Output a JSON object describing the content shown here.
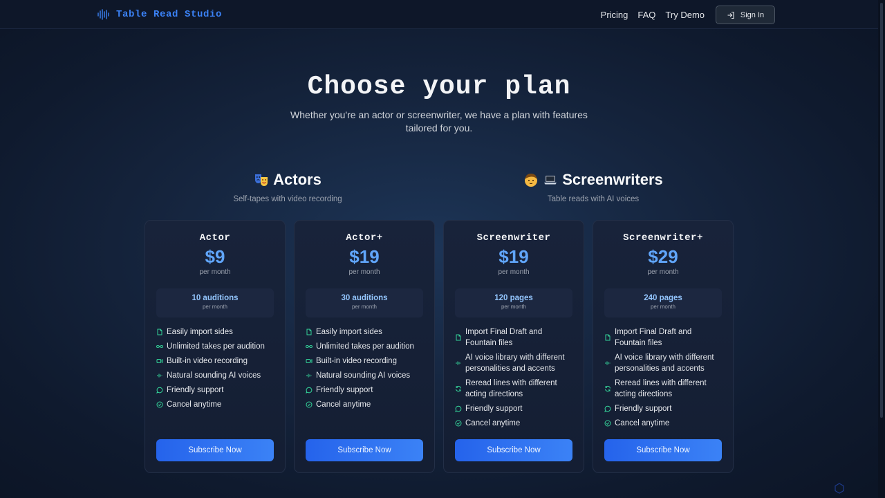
{
  "header": {
    "brand": "Table Read Studio",
    "nav": [
      "Pricing",
      "FAQ",
      "Try Demo"
    ],
    "signin_label": "Sign In"
  },
  "hero": {
    "title": "Choose your plan",
    "subtitle": "Whether you're an actor or screenwriter, we have a plan with features tailored for you."
  },
  "groups": [
    {
      "title": "Actors",
      "subtitle": "Self-tapes with video recording",
      "icons": [
        "theater-masks-icon"
      ]
    },
    {
      "title": "Screenwriters",
      "subtitle": "Table reads with AI voices",
      "icons": [
        "person-icon",
        "laptop-icon"
      ]
    }
  ],
  "plans": [
    {
      "name": "Actor",
      "price": "$9",
      "period": "per month",
      "quota": "10 auditions",
      "quota_period": "per month",
      "features": [
        {
          "icon": "document-icon",
          "text": "Easily import sides"
        },
        {
          "icon": "infinity-icon",
          "text": "Unlimited takes per audition"
        },
        {
          "icon": "video-icon",
          "text": "Built-in video recording"
        },
        {
          "icon": "waveform-icon",
          "text": "Natural sounding AI voices"
        },
        {
          "icon": "chat-bubble-icon",
          "text": "Friendly support"
        },
        {
          "icon": "check-circle-icon",
          "text": "Cancel anytime"
        }
      ],
      "cta": "Subscribe Now"
    },
    {
      "name": "Actor+",
      "price": "$19",
      "period": "per month",
      "quota": "30 auditions",
      "quota_period": "per month",
      "features": [
        {
          "icon": "document-icon",
          "text": "Easily import sides"
        },
        {
          "icon": "infinity-icon",
          "text": "Unlimited takes per audition"
        },
        {
          "icon": "video-icon",
          "text": "Built-in video recording"
        },
        {
          "icon": "waveform-icon",
          "text": "Natural sounding AI voices"
        },
        {
          "icon": "chat-bubble-icon",
          "text": "Friendly support"
        },
        {
          "icon": "check-circle-icon",
          "text": "Cancel anytime"
        }
      ],
      "cta": "Subscribe Now"
    },
    {
      "name": "Screenwriter",
      "price": "$19",
      "period": "per month",
      "quota": "120 pages",
      "quota_period": "per month",
      "features": [
        {
          "icon": "document-icon",
          "text": "Import Final Draft and Fountain files"
        },
        {
          "icon": "waveform-icon",
          "text": "AI voice library with different personalities and accents"
        },
        {
          "icon": "refresh-icon",
          "text": "Reread lines with different acting directions"
        },
        {
          "icon": "chat-bubble-icon",
          "text": "Friendly support"
        },
        {
          "icon": "check-circle-icon",
          "text": "Cancel anytime"
        }
      ],
      "cta": "Subscribe Now"
    },
    {
      "name": "Screenwriter+",
      "price": "$29",
      "period": "per month",
      "quota": "240 pages",
      "quota_period": "per month",
      "features": [
        {
          "icon": "document-icon",
          "text": "Import Final Draft and Fountain files"
        },
        {
          "icon": "waveform-icon",
          "text": "AI voice library with different personalities and accents"
        },
        {
          "icon": "refresh-icon",
          "text": "Reread lines with different acting directions"
        },
        {
          "icon": "chat-bubble-icon",
          "text": "Friendly support"
        },
        {
          "icon": "check-circle-icon",
          "text": "Cancel anytime"
        }
      ],
      "cta": "Subscribe Now"
    }
  ],
  "colors": {
    "accent": "#3b82f6",
    "price": "#60a5fa",
    "feature_icon": "#34d399",
    "background": "#15243d"
  }
}
